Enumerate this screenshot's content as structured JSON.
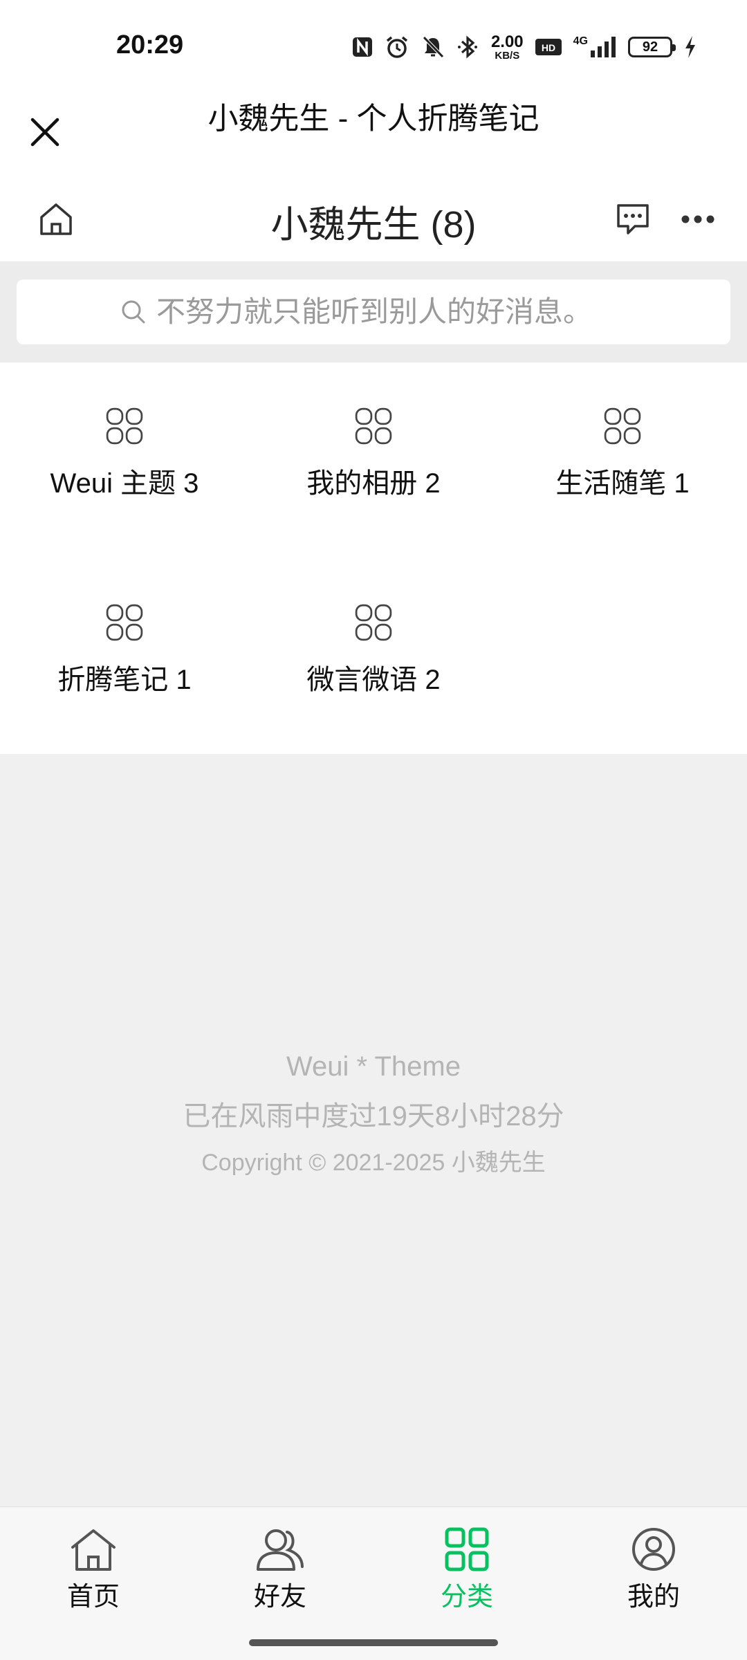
{
  "status_bar": {
    "time": "20:29",
    "net_speed_value": "2.00",
    "net_speed_unit": "KB/S",
    "network": "4G",
    "battery": "92",
    "icons": [
      "nfc-icon",
      "alarm-icon",
      "mute-icon",
      "bluetooth-icon",
      "hd-icon",
      "signal-icon",
      "battery-icon",
      "charging-icon"
    ]
  },
  "webview": {
    "title": "小魏先生 - 个人折腾笔记",
    "close_icon": "close-icon"
  },
  "site_header": {
    "title": "小魏先生 (8)",
    "home_icon": "home-icon",
    "message_icon": "message-icon",
    "more_icon": "more-icon"
  },
  "search": {
    "placeholder": "不努力就只能听到别人的好消息。"
  },
  "categories": [
    {
      "label": "Weui 主题 3"
    },
    {
      "label": "我的相册 2"
    },
    {
      "label": "生活随笔 1"
    },
    {
      "label": "折腾笔记 1"
    },
    {
      "label": "微言微语 2"
    }
  ],
  "footer": {
    "theme": "Weui * Theme",
    "uptime": "已在风雨中度过19天8小时28分",
    "copyright": "Copyright © 2021-2025 小魏先生"
  },
  "tabs": [
    {
      "label": "首页",
      "icon": "home-icon",
      "active": false
    },
    {
      "label": "好友",
      "icon": "friends-icon",
      "active": false
    },
    {
      "label": "分类",
      "icon": "category-grid-icon",
      "active": true
    },
    {
      "label": "我的",
      "icon": "profile-icon",
      "active": false
    }
  ],
  "colors": {
    "accent": "#07c160",
    "text": "#111111",
    "muted": "#b4b4b4",
    "background": "#f0f0f0"
  }
}
